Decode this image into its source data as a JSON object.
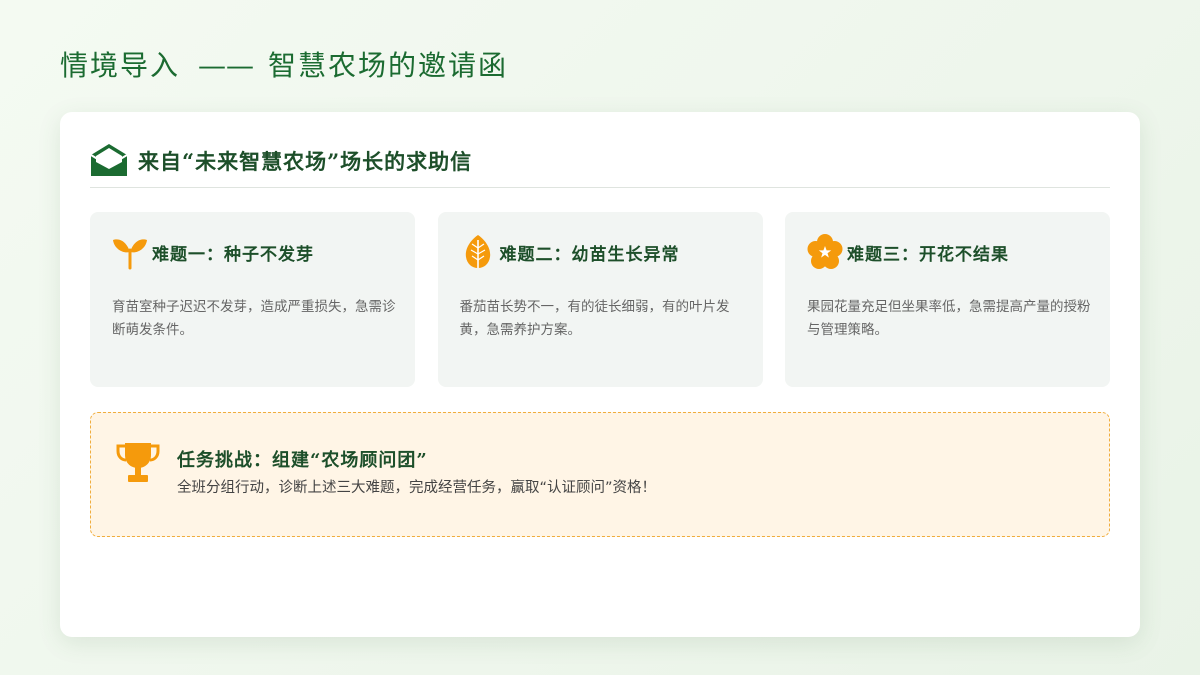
{
  "header": {
    "title_main": "情境导入",
    "title_dash": "——",
    "title_sub": "智慧农场的邀请函"
  },
  "letter": {
    "icon": "envelope-icon",
    "title": "来自“未来智慧农场”场长的求助信"
  },
  "problems": [
    {
      "icon": "sprout-icon",
      "title": "难题一：种子不发芽",
      "description": "育苗室种子迟迟不发芽，造成严重损失，急需诊断萌发条件。"
    },
    {
      "icon": "leaf-icon",
      "title": "难题二：幼苗生长异常",
      "description": "番茄苗长势不一，有的徒长细弱，有的叶片发黄，急需养护方案。"
    },
    {
      "icon": "flower-icon",
      "title": "难题三：开花不结果",
      "description": "果园花量充足但坐果率低，急需提高产量的授粉与管理策略。"
    }
  ],
  "task": {
    "icon": "trophy-icon",
    "title": "任务挑战：组建“农场顾问团”",
    "description": "全班分组行动，诊断上述三大难题，完成经营任务，赢取“认证顾问”资格！"
  },
  "colors": {
    "primary_green": "#1b6b31",
    "accent_orange": "#f59a0c",
    "task_background": "#fff5e6",
    "task_border": "#f0ad3d"
  }
}
